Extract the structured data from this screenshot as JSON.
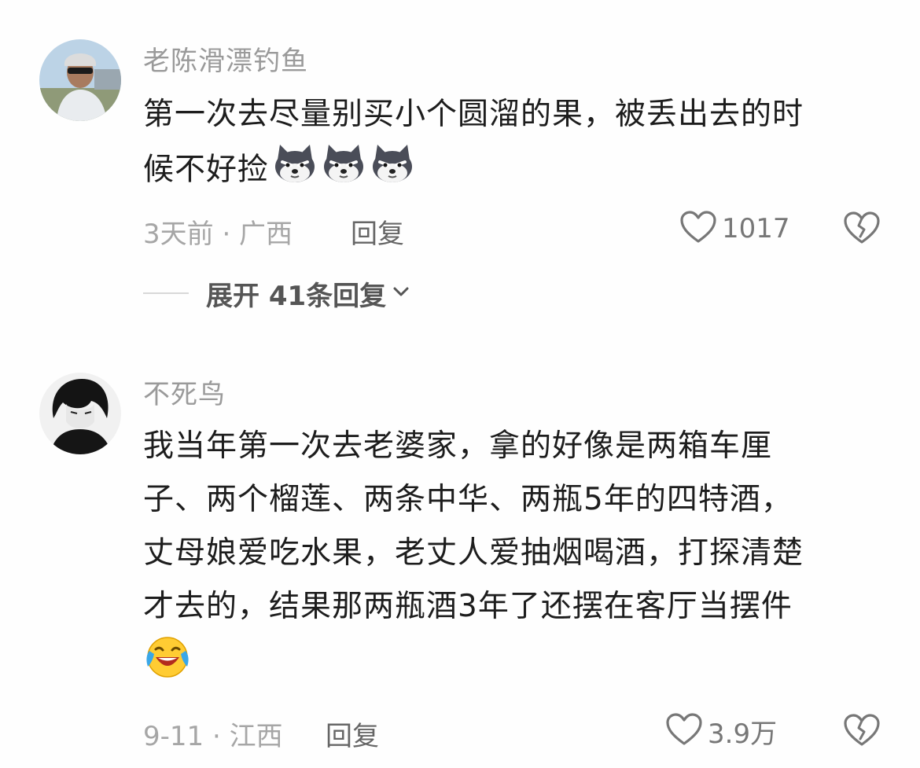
{
  "comments": [
    {
      "username": "老陈滑漂钓鱼",
      "lines": [
        "第一次去尽量别买小个圆溜的果，被丢出去的时",
        "候不好捡"
      ],
      "inline_emojis": [
        "husky-smirk-emoji",
        "husky-smirk-emoji",
        "husky-smirk-emoji"
      ],
      "meta": "3天前 · 广西",
      "reply_label": "回复",
      "like_count": "1017",
      "expand_label": "展开 41条回复"
    },
    {
      "username": "不死鸟",
      "lines": [
        "我当年第一次去老婆家，拿的好像是两箱车厘",
        "子、两个榴莲、两条中华、两瓶5年的四特酒，",
        "丈母娘爱吃水果，老丈人爱抽烟喝酒，打探清楚",
        "才去的，结果那两瓶酒3年了还摆在客厅当摆件"
      ],
      "inline_emojis": [
        "laugh-cry-emoji"
      ],
      "meta": "9-11 · 江西",
      "reply_label": "回复",
      "like_count": "3.9万"
    }
  ],
  "icons": {
    "like": "heart-outline-icon",
    "dislike": "broken-heart-icon",
    "expand": "chevron-down-icon"
  },
  "colors": {
    "username": "#9a9a9a",
    "body": "#1d1d1d",
    "meta": "#a6a6a6",
    "reply": "#666666"
  }
}
